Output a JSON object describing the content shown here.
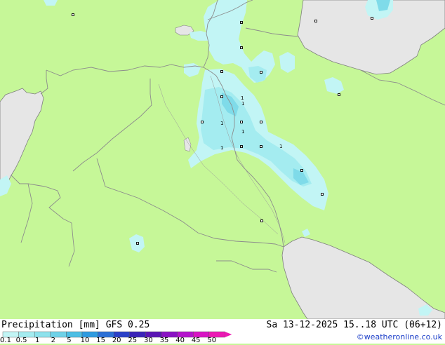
{
  "title": "Precipitation [mm]  GFS 0.25",
  "valid_time": "Sa 13-12-2025 15..18 UTC (06+12)",
  "credit": "©weatheronline.co.uk",
  "legend": {
    "ticks": [
      "0.1",
      "0.5",
      "1",
      "2",
      "5",
      "10",
      "15",
      "20",
      "25",
      "30",
      "35",
      "40",
      "45",
      "50"
    ],
    "colors": [
      "#c2f5f5",
      "#a4ecf0",
      "#8ee2ec",
      "#6fd2e8",
      "#4cbee4",
      "#2e9be0",
      "#2b6fd6",
      "#2a40c8",
      "#3a22b8",
      "#5a14b4",
      "#8a12c4",
      "#b414cc",
      "#d814c4",
      "#ec18b4"
    ]
  },
  "colors": {
    "land": "#c6f798",
    "sea": "#e6e6e6",
    "precip_light": "#c2f5f5",
    "precip_medium": "#a4ecf0",
    "precip_strong": "#7fdbe9",
    "border": "#8c8c8c"
  },
  "map_labels": [
    "1",
    "1",
    "1",
    "1",
    "1",
    "1"
  ]
}
